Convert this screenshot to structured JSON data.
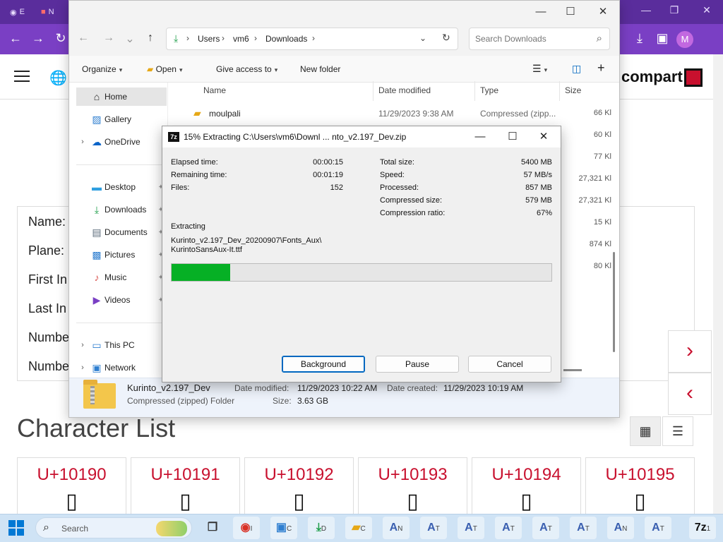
{
  "browser": {
    "tabs": [
      {
        "label": "E",
        "icon": "globe-icon"
      },
      {
        "label": "N",
        "icon": "app-icon"
      }
    ],
    "site": {
      "info_labels": [
        "Name:",
        "Plane:",
        "First In",
        "Last In",
        "Numbe",
        "Numbe"
      ],
      "section_title": "Character List",
      "char_cards": [
        {
          "code": "U+10190",
          "glyph": "▯"
        },
        {
          "code": "U+10191",
          "glyph": "▯"
        },
        {
          "code": "U+10192",
          "glyph": "▯"
        },
        {
          "code": "U+10193",
          "glyph": "▯"
        },
        {
          "code": "U+10194",
          "glyph": "▯"
        },
        {
          "code": "U+10195",
          "glyph": "▯"
        }
      ],
      "logo_text": "compart",
      "avatar_letter": "M",
      "brand_color": "#c8102e"
    }
  },
  "explorer": {
    "breadcrumb": [
      "Users",
      "vm6",
      "Downloads"
    ],
    "search_placeholder": "Search Downloads",
    "commands": {
      "organize": "Organize",
      "open": "Open",
      "give_access": "Give access to",
      "new_folder": "New folder"
    },
    "nav": {
      "home": "Home",
      "gallery": "Gallery",
      "onedrive": "OneDrive",
      "desktop": "Desktop",
      "downloads": "Downloads",
      "documents": "Documents",
      "pictures": "Pictures",
      "music": "Music",
      "videos": "Videos",
      "this_pc": "This PC",
      "network": "Network"
    },
    "columns": {
      "name": "Name",
      "date": "Date modified",
      "type": "Type",
      "size": "Size"
    },
    "file_row": {
      "name": "moulpali",
      "date": "11/29/2023 9:38 AM",
      "type": "Compressed (zipp...",
      "size": "66 Kl"
    },
    "sizes": [
      "60 Kl",
      "77 Kl",
      "27,321 Kl",
      "27,321 Kl",
      "15 Kl",
      "874 Kl",
      "80 Kl"
    ],
    "details": {
      "name": "Kurinto_v2.197_Dev",
      "type": "Compressed (zipped) Folder",
      "date_modified_label": "Date modified:",
      "date_modified": "11/29/2023 10:22 AM",
      "date_created_label": "Date created:",
      "date_created": "11/29/2023 10:19 AM",
      "size_label": "Size:",
      "size": "3.63 GB"
    }
  },
  "dialog": {
    "app_badge": "7z",
    "title": "15% Extracting C:\\Users\\vm6\\Downl ... nto_v2.197_Dev.zip",
    "stats_left": [
      {
        "label": "Elapsed time:",
        "value": "00:00:15"
      },
      {
        "label": "Remaining time:",
        "value": "00:01:19"
      },
      {
        "label": "Files:",
        "value": "152"
      }
    ],
    "stats_right": [
      {
        "label": "Total size:",
        "value": "5400 MB"
      },
      {
        "label": "Speed:",
        "value": "57 MB/s"
      },
      {
        "label": "Processed:",
        "value": "857 MB"
      },
      {
        "label": "Compressed size:",
        "value": "579 MB"
      },
      {
        "label": "Compression ratio:",
        "value": "67%"
      }
    ],
    "extracting_label": "Extracting",
    "current_path_line1": "Kurinto_v2.197_Dev_20200907\\Fonts_Aux\\",
    "current_path_line2": "KurintoSansAux-It.ttf",
    "progress_fraction": 0.155,
    "progress_color": "#06b025",
    "buttons": {
      "background": "Background",
      "pause": "Pause",
      "cancel": "Cancel"
    }
  },
  "taskbar": {
    "search_label": "Search",
    "apps": [
      {
        "icon": "chrome-icon",
        "sub": "I"
      },
      {
        "icon": "control-panel-icon",
        "sub": "C"
      },
      {
        "icon": "downloads-icon",
        "sub": "D"
      },
      {
        "icon": "folder-icon",
        "sub": "C"
      },
      {
        "icon": "font-icon",
        "sub": "N"
      },
      {
        "icon": "font-icon",
        "sub": "T"
      },
      {
        "icon": "font-icon",
        "sub": "T"
      },
      {
        "icon": "font-icon",
        "sub": "T"
      },
      {
        "icon": "font-icon",
        "sub": "T"
      },
      {
        "icon": "font-icon",
        "sub": "T"
      },
      {
        "icon": "font-icon",
        "sub": "N"
      },
      {
        "icon": "font-icon",
        "sub": "T"
      },
      {
        "icon": "sevenzip-icon",
        "sub": "1"
      }
    ]
  }
}
